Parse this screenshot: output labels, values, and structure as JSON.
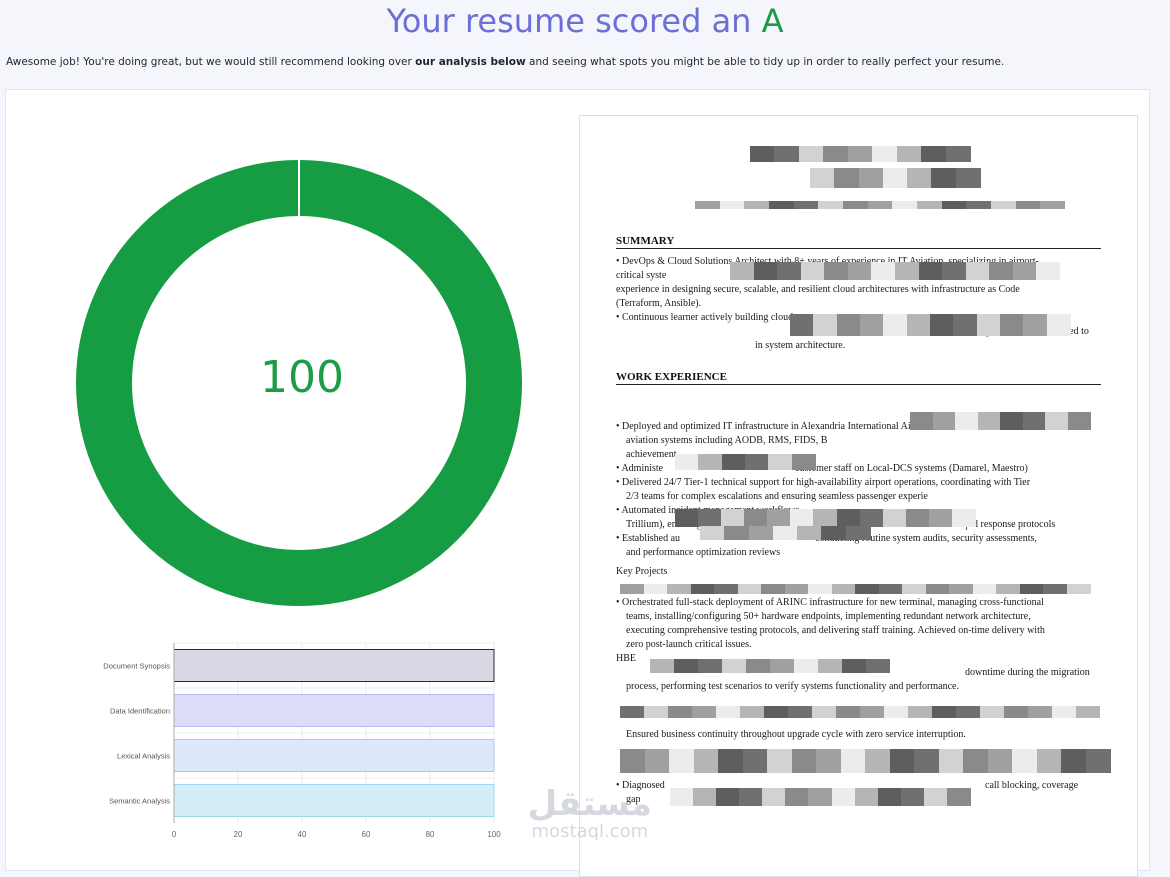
{
  "header": {
    "title_prefix": "Your resume scored an ",
    "grade": "A",
    "intro_before": "Awesome job! You're doing great, but we would still recommend looking over ",
    "intro_bold": "our analysis below",
    "intro_after": " and seeing what spots you might be able to tidy up in order to really perfect your resume."
  },
  "score": {
    "value": 100,
    "max": 100,
    "display": "100",
    "ring_color": "#169c42"
  },
  "chart_data": {
    "type": "bar",
    "orientation": "horizontal",
    "categories": [
      "Document Synopsis",
      "Data Identification",
      "Lexical Analysis",
      "Semantic Analysis"
    ],
    "values": [
      100,
      100,
      100,
      100
    ],
    "xlim": [
      0,
      100
    ],
    "xticks": [
      0,
      20,
      40,
      60,
      80,
      100
    ],
    "grid": true,
    "colors": [
      "#d8d8e4",
      "#dcdcf8",
      "#dde9fb",
      "#d4eef8"
    ],
    "border_colors": [
      "#2a2a2a",
      "#b9b9ee",
      "#a9c8ef",
      "#9bd8ec"
    ]
  },
  "resume": {
    "lines": [
      {
        "k": "h1",
        "t": "SUMMARY"
      },
      {
        "k": "t1",
        "t": "•  DevOps & Cloud Solutions Architect with 8+ years of experience in IT Aviation, specializing in airport-"
      },
      {
        "k": "t2",
        "t": "critical syste"
      },
      {
        "k": "t3",
        "t": "experience in designing secure, scalable, and resilient cloud architectures with infrastructure as Code"
      },
      {
        "k": "t4",
        "t": "(Terraform, Ansible)."
      },
      {
        "k": "t5",
        "t": "•   Continuous learner actively building cloud-nat"
      },
      {
        "k": "t6",
        "t": "ng solutions. Committed to"
      },
      {
        "k": "t7",
        "t": "in system architecture."
      },
      {
        "k": "h2",
        "t": "WORK EXPERIENCE"
      },
      {
        "k": "t8",
        "t": "•  Deployed and optimized IT infrastructure in Alexandria International Air"
      },
      {
        "k": "t9",
        "t": "aviation systems including AODB, RMS, FIDS, B"
      },
      {
        "k": "t10",
        "t": "achievement."
      },
      {
        "k": "t11",
        "t": "•  Administe"
      },
      {
        "k": "t12",
        "t": "customer staff on Local-DCS systems (Damarel, Maestro)"
      },
      {
        "k": "t13",
        "t": "•  Delivered 24/7 Tier-1 technical support for high-availability airport operations, coordinating with Tier"
      },
      {
        "k": "t14",
        "t": "2/3 teams for complex escalations and ensuring seamless passenger experie"
      },
      {
        "k": "t15",
        "t": "•  Automated incident management workflows"
      },
      {
        "k": "t16",
        "t": "Trillium), ensuring 100%"
      },
      {
        "k": "t17",
        "t": "d rapid response protocols"
      },
      {
        "k": "t18",
        "t": "•  Established au"
      },
      {
        "k": "t19",
        "t": "conducting routine system audits, security assessments,"
      },
      {
        "k": "t20",
        "t": "and performance optimization reviews"
      },
      {
        "k": "t21",
        "t": "Key Projects"
      },
      {
        "k": "t22",
        "t": "•  Orchestrated full-stack deployment of ARINC infrastructure for new terminal, managing cross-functional"
      },
      {
        "k": "t23",
        "t": "teams, installing/configuring 50+ hardware endpoints, implementing redundant network architecture,"
      },
      {
        "k": "t24",
        "t": "executing comprehensive testing protocols, and delivering staff training. Achieved on-time delivery with"
      },
      {
        "k": "t25",
        "t": "zero post-launch critical issues."
      },
      {
        "k": "t26",
        "t": "HBE"
      },
      {
        "k": "t27",
        "t": "downtime during the migration"
      },
      {
        "k": "t28",
        "t": "process, performing test scenarios to verify systems functionality and performance."
      },
      {
        "k": "t29",
        "t": "Ensured business continuity throughout upgrade cycle with zero service interruption."
      },
      {
        "k": "t30",
        "t": "•  Diagnosed"
      },
      {
        "k": "t31",
        "t": "call blocking, coverage"
      },
      {
        "k": "t32",
        "t": "gap"
      }
    ]
  },
  "watermark": {
    "arabic": "مستقل",
    "latin": "mostaql.com"
  }
}
